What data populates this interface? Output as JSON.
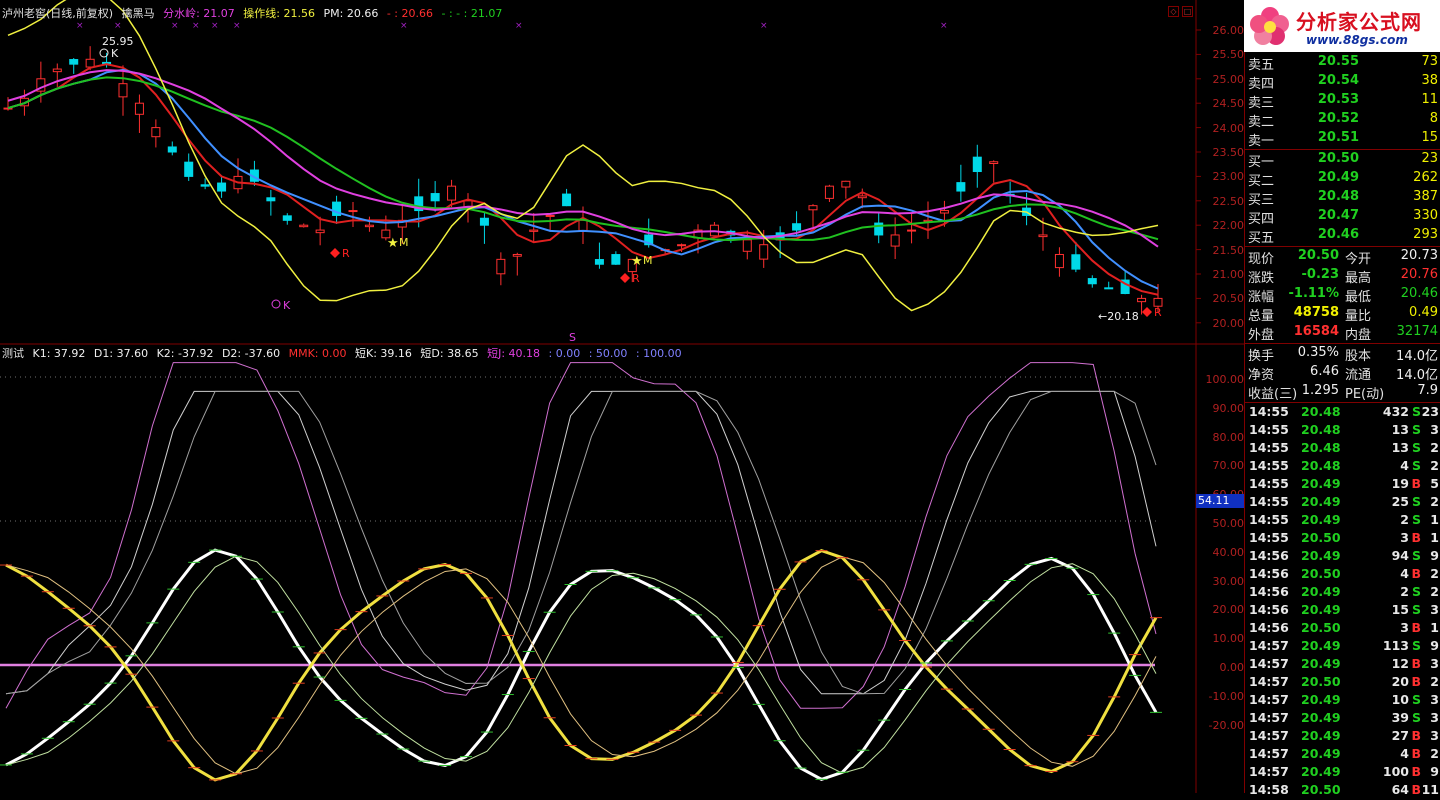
{
  "header": {
    "title": "泸州老窖(日线,前复权)",
    "indicator": "擒黑马",
    "items": [
      {
        "label": "分水岭: 21.07",
        "color": "#e040e0"
      },
      {
        "label": "操作线: 21.56",
        "color": "#f0f040"
      },
      {
        "label": "PM: 20.66",
        "color": "#f0f0f0"
      },
      {
        "label": "- : 20.66",
        "color": "#ff3030"
      },
      {
        "label": "- : - : 21.07",
        "color": "#20d020"
      }
    ]
  },
  "indicator_header": {
    "name": "测试",
    "items": [
      {
        "label": "K1: 37.92",
        "color": "#f0f0f0"
      },
      {
        "label": "D1: 37.60",
        "color": "#f0f0f0"
      },
      {
        "label": "K2: -37.92",
        "color": "#f0f0f0"
      },
      {
        "label": "D2: -37.60",
        "color": "#f0f0f0"
      },
      {
        "label": "MMK: 0.00",
        "color": "#ff3030"
      },
      {
        "label": "短K: 39.16",
        "color": "#f0f0f0"
      },
      {
        "label": "短D: 38.65",
        "color": "#f0f0f0"
      },
      {
        "label": "短J: 40.18",
        "color": "#e040e0"
      },
      {
        "label": ": 0.00",
        "color": "#8080ff"
      },
      {
        "label": ": 50.00",
        "color": "#8080ff"
      },
      {
        "label": ": 100.00",
        "color": "#8080ff"
      }
    ]
  },
  "annotations": {
    "high_label": "25.95",
    "low_label": "←20.18",
    "k_mark": "K",
    "r_mark": "R",
    "m_mark": "M",
    "s_mark": "S",
    "cursor_value": "54.11"
  },
  "price_axis": [
    "26.00",
    "25.50",
    "25.00",
    "24.50",
    "24.00",
    "23.50",
    "23.00",
    "22.50",
    "22.00",
    "21.50",
    "21.00",
    "20.50",
    "20.00"
  ],
  "ind_axis": [
    "100.00",
    "90.00",
    "80.00",
    "70.00",
    "60.00",
    "50.00",
    "40.00",
    "30.00",
    "20.00",
    "10.00",
    "0.00",
    "-10.00",
    "-20.00"
  ],
  "logo": {
    "name": "分析家公式网",
    "url": "www.88gs.com"
  },
  "order_book": {
    "asks": [
      {
        "label": "卖五",
        "price": "20.55",
        "vol": "73"
      },
      {
        "label": "卖四",
        "price": "20.54",
        "vol": "38"
      },
      {
        "label": "卖三",
        "price": "20.53",
        "vol": "11"
      },
      {
        "label": "卖二",
        "price": "20.52",
        "vol": "8"
      },
      {
        "label": "卖一",
        "price": "20.51",
        "vol": "15"
      }
    ],
    "bids": [
      {
        "label": "买一",
        "price": "20.50",
        "vol": "23"
      },
      {
        "label": "买二",
        "price": "20.49",
        "vol": "262"
      },
      {
        "label": "买三",
        "price": "20.48",
        "vol": "387"
      },
      {
        "label": "买四",
        "price": "20.47",
        "vol": "330"
      },
      {
        "label": "买五",
        "price": "20.46",
        "vol": "293"
      }
    ]
  },
  "quote": [
    {
      "l1": "现价",
      "v1": "20.50",
      "c1": "g",
      "l2": "今开",
      "v2": "20.73",
      "c2": "w"
    },
    {
      "l1": "涨跌",
      "v1": "-0.23",
      "c1": "g",
      "l2": "最高",
      "v2": "20.76",
      "c2": "r"
    },
    {
      "l1": "涨幅",
      "v1": "-1.11%",
      "c1": "g",
      "l2": "最低",
      "v2": "20.46",
      "c2": "g"
    },
    {
      "l1": "总量",
      "v1": "48758",
      "c1": "y",
      "l2": "量比",
      "v2": "0.49",
      "c2": "y"
    },
    {
      "l1": "外盘",
      "v1": "16584",
      "c1": "r",
      "l2": "内盘",
      "v2": "32174",
      "c2": "g"
    }
  ],
  "fundamentals": [
    {
      "l1": "换手",
      "v1": "0.35%",
      "l2": "股本",
      "v2": "14.0亿"
    },
    {
      "l1": "净资",
      "v1": "6.46",
      "l2": "流通",
      "v2": "14.0亿"
    },
    {
      "l1": "收益(三)",
      "v1": "1.295",
      "l2": "PE(动)",
      "v2": "7.9"
    }
  ],
  "ticks": [
    {
      "t": "14:55",
      "p": "20.48",
      "c": "g",
      "v": "432",
      "d": "S",
      "n": "23"
    },
    {
      "t": "14:55",
      "p": "20.48",
      "c": "g",
      "v": "13",
      "d": "S",
      "n": "3"
    },
    {
      "t": "14:55",
      "p": "20.48",
      "c": "g",
      "v": "13",
      "d": "S",
      "n": "2"
    },
    {
      "t": "14:55",
      "p": "20.48",
      "c": "g",
      "v": "4",
      "d": "S",
      "n": "2"
    },
    {
      "t": "14:55",
      "p": "20.49",
      "c": "g",
      "v": "19",
      "d": "B",
      "n": "5"
    },
    {
      "t": "14:55",
      "p": "20.49",
      "c": "g",
      "v": "25",
      "d": "S",
      "n": "2"
    },
    {
      "t": "14:55",
      "p": "20.49",
      "c": "g",
      "v": "2",
      "d": "S",
      "n": "1"
    },
    {
      "t": "14:55",
      "p": "20.50",
      "c": "g",
      "v": "3",
      "d": "B",
      "n": "1"
    },
    {
      "t": "14:56",
      "p": "20.49",
      "c": "g",
      "v": "94",
      "d": "S",
      "n": "9"
    },
    {
      "t": "14:56",
      "p": "20.50",
      "c": "g",
      "v": "4",
      "d": "B",
      "n": "2"
    },
    {
      "t": "14:56",
      "p": "20.49",
      "c": "g",
      "v": "2",
      "d": "S",
      "n": "2"
    },
    {
      "t": "14:56",
      "p": "20.49",
      "c": "g",
      "v": "15",
      "d": "S",
      "n": "3"
    },
    {
      "t": "14:56",
      "p": "20.50",
      "c": "g",
      "v": "3",
      "d": "B",
      "n": "1"
    },
    {
      "t": "14:57",
      "p": "20.49",
      "c": "g",
      "v": "113",
      "d": "S",
      "n": "9"
    },
    {
      "t": "14:57",
      "p": "20.49",
      "c": "g",
      "v": "12",
      "d": "B",
      "n": "3"
    },
    {
      "t": "14:57",
      "p": "20.50",
      "c": "g",
      "v": "20",
      "d": "B",
      "n": "2"
    },
    {
      "t": "14:57",
      "p": "20.49",
      "c": "g",
      "v": "10",
      "d": "S",
      "n": "3"
    },
    {
      "t": "14:57",
      "p": "20.49",
      "c": "g",
      "v": "39",
      "d": "S",
      "n": "3"
    },
    {
      "t": "14:57",
      "p": "20.49",
      "c": "g",
      "v": "27",
      "d": "B",
      "n": "3"
    },
    {
      "t": "14:57",
      "p": "20.49",
      "c": "g",
      "v": "4",
      "d": "B",
      "n": "2"
    },
    {
      "t": "14:57",
      "p": "20.49",
      "c": "g",
      "v": "100",
      "d": "B",
      "n": "9"
    },
    {
      "t": "14:58",
      "p": "20.50",
      "c": "g",
      "v": "64",
      "d": "B",
      "n": "11"
    }
  ],
  "colors": {
    "up": "#ff3030",
    "down": "#00d8e8",
    "ma_red": "#e02020",
    "ma_mag": "#e040e0",
    "ma_blue": "#4090ff",
    "ma_green": "#20c020",
    "yellow": "#f0f040",
    "frame": "#800000"
  }
}
